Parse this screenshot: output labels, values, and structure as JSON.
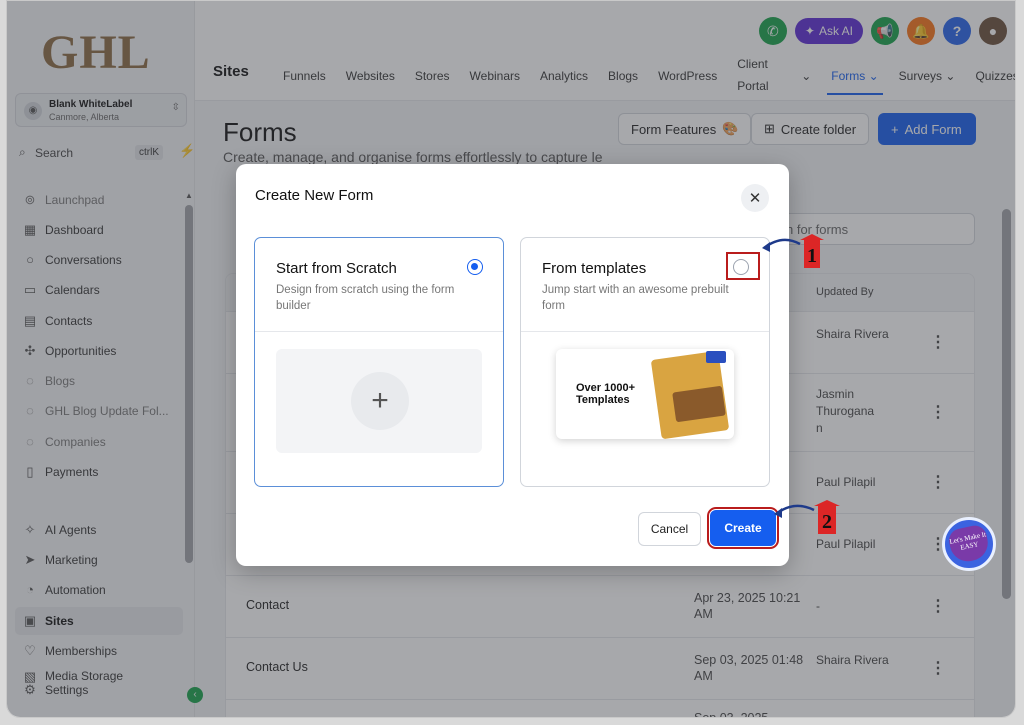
{
  "brand": {
    "logo_text": "GHL"
  },
  "location": {
    "name": "Blank WhiteLabel",
    "sub": "Canmore, Alberta"
  },
  "search": {
    "label": "Search",
    "shortcut": "ctrlK"
  },
  "sidebar": {
    "items": [
      {
        "label": "Launchpad",
        "icon": "rocket-icon"
      },
      {
        "label": "Dashboard",
        "icon": "grid-icon"
      },
      {
        "label": "Conversations",
        "icon": "chat-icon"
      },
      {
        "label": "Calendars",
        "icon": "calendar-icon"
      },
      {
        "label": "Contacts",
        "icon": "contacts-icon"
      },
      {
        "label": "Opportunities",
        "icon": "funnel-icon"
      },
      {
        "label": "Blogs",
        "icon": "blog-icon"
      },
      {
        "label": "GHL Blog Update Fol...",
        "icon": "folder-icon"
      },
      {
        "label": "Companies",
        "icon": "building-icon"
      },
      {
        "label": "Payments",
        "icon": "payments-icon"
      },
      {
        "label": "AI Agents",
        "icon": "sparkle-icon"
      },
      {
        "label": "Marketing",
        "icon": "send-icon"
      },
      {
        "label": "Automation",
        "icon": "automation-icon"
      },
      {
        "label": "Sites",
        "icon": "sites-icon"
      },
      {
        "label": "Memberships",
        "icon": "memberships-icon"
      },
      {
        "label": "Media Storage",
        "icon": "media-icon"
      },
      {
        "label": "Settings",
        "icon": "gear-icon"
      }
    ]
  },
  "topbar": {
    "ask_ai": "Ask AI",
    "help": "?",
    "section_title": "Sites",
    "tabs": [
      "Funnels",
      "Websites",
      "Stores",
      "Webinars",
      "Analytics",
      "Blogs",
      "WordPress",
      "Client Portal",
      "Forms",
      "Surveys",
      "Quizzes"
    ]
  },
  "page": {
    "title": "Forms",
    "subtitle": "Create, manage, and organise forms effortlessly to capture le",
    "buttons": {
      "features": "Form Features",
      "create_folder": "Create folder",
      "add_form": "Add Form"
    },
    "search_placeholder": "h for forms",
    "table": {
      "col_updated_by": "Updated By",
      "rows": [
        {
          "name": "",
          "date": "",
          "by": "Shaira Rivera"
        },
        {
          "name": "",
          "date": "",
          "by": "Jasmin Thurogana n"
        },
        {
          "name": "",
          "date": "",
          "by": "Paul Pilapil"
        },
        {
          "name": "",
          "date": "",
          "by": "Paul Pilapil"
        },
        {
          "name": "Contact",
          "date": "Apr 23, 2025 10:21 AM",
          "by": "-"
        },
        {
          "name": "Contact Us",
          "date": "Sep 03, 2025 01:48 AM",
          "by": "Shaira Rivera"
        },
        {
          "name": "",
          "date": "Sep 03, 2025",
          "by": ""
        }
      ]
    }
  },
  "dialog": {
    "title": "Create New Form",
    "scratch": {
      "title": "Start from Scratch",
      "desc": "Design from scratch using the form builder",
      "selected": true
    },
    "templates": {
      "title": "From templates",
      "desc": "Jump start with an awesome prebuilt form",
      "image_text": "Over 1000+ Templates",
      "selected": false
    },
    "cancel": "Cancel",
    "create": "Create"
  },
  "annotations": {
    "step1": "1",
    "step2": "2"
  },
  "badge": {
    "text": "Let's Make It EASY"
  },
  "colors": {
    "primary": "#155eef",
    "annotation_red": "#b91c1c",
    "arrow": "#1e3a8a"
  }
}
